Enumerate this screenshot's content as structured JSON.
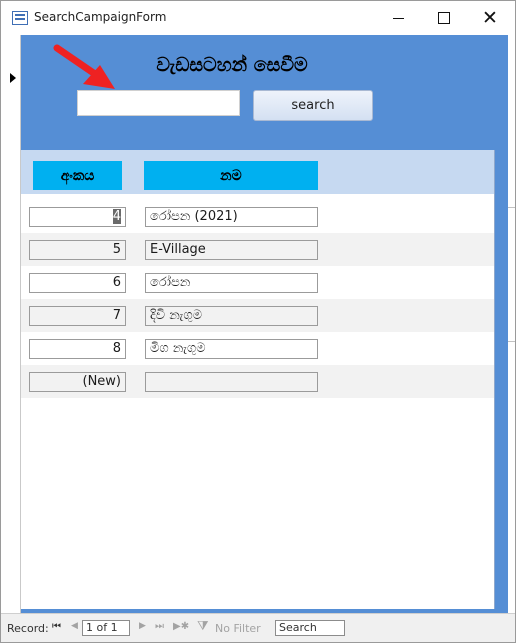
{
  "window": {
    "title": "SearchCampaignForm",
    "icon": "access-form-icon",
    "controls": {
      "minimize": "minimize-icon",
      "maximize": "maximize-icon",
      "close": "✕"
    }
  },
  "form": {
    "title": "වැඩසටහන් සෙවීම",
    "search": {
      "value": "",
      "placeholder": "",
      "button_label": "search"
    },
    "annotation": {
      "icon": "red-arrow-icon",
      "color": "#ee2222"
    },
    "colors": {
      "header_bg": "#558ed5",
      "column_header_bg": "#00b0f0",
      "header_band_bg": "#c6d9f1"
    },
    "columns": {
      "id": "අංකය",
      "name": "නම"
    },
    "rows": [
      {
        "id": "4",
        "name": "රෝපන (2021)"
      },
      {
        "id": "5",
        "name": "E-Village"
      },
      {
        "id": "6",
        "name": "රෝපන"
      },
      {
        "id": "7",
        "name": "දිවි නැගුම"
      },
      {
        "id": "8",
        "name": "මිග නැගුම"
      },
      {
        "id": "(New)",
        "name": ""
      }
    ]
  },
  "navigation": {
    "record_label": "Record:",
    "position": "1 of 1",
    "filter_label": "No Filter",
    "search_value": "Search"
  }
}
